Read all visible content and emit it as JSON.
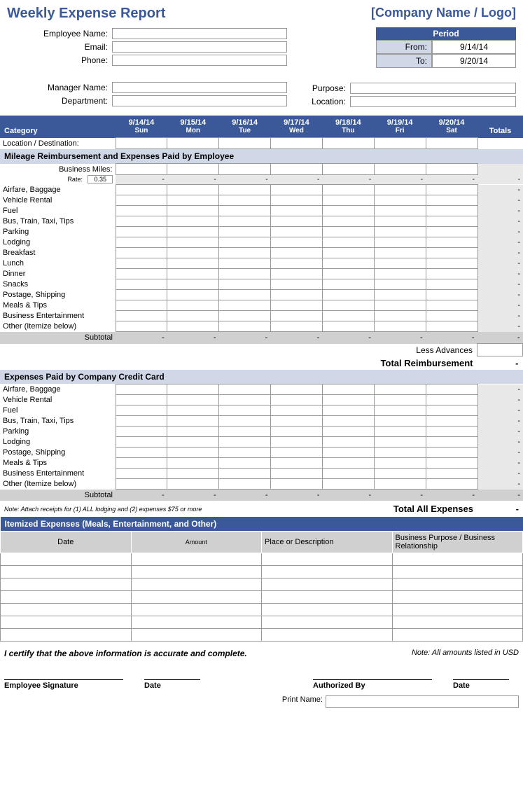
{
  "title": "Weekly Expense Report",
  "company": "[Company Name / Logo]",
  "fields": {
    "employee_name": "Employee Name:",
    "email": "Email:",
    "phone": "Phone:",
    "manager_name": "Manager Name:",
    "department": "Department:",
    "purpose": "Purpose:",
    "location": "Location:"
  },
  "period": {
    "header": "Period",
    "from_label": "From:",
    "from_value": "9/14/14",
    "to_label": "To:",
    "to_value": "9/20/14"
  },
  "columns": {
    "category": "Category",
    "days": [
      {
        "date": "9/14/14",
        "dow": "Sun"
      },
      {
        "date": "9/15/14",
        "dow": "Mon"
      },
      {
        "date": "9/16/14",
        "dow": "Tue"
      },
      {
        "date": "9/17/14",
        "dow": "Wed"
      },
      {
        "date": "9/18/14",
        "dow": "Thu"
      },
      {
        "date": "9/19/14",
        "dow": "Fri"
      },
      {
        "date": "9/20/14",
        "dow": "Sat"
      }
    ],
    "totals": "Totals"
  },
  "location_row": "Location / Destination:",
  "section1": {
    "title": "Mileage Reimbursement and Expenses Paid by Employee",
    "business_miles": "Business Miles:",
    "rate_label": "Rate:",
    "rate_value": "0.35",
    "dash": "-",
    "categories": [
      "Airfare, Baggage",
      "Vehicle Rental",
      "Fuel",
      "Bus, Train, Taxi, Tips",
      "Parking",
      "Lodging",
      "Breakfast",
      "Lunch",
      "Dinner",
      "Snacks",
      "Postage, Shipping",
      "Meals & Tips",
      "Business Entertainment",
      "Other (Itemize below)"
    ],
    "subtotal": "Subtotal",
    "less_advances": "Less Advances",
    "total_reimbursement": "Total Reimbursement"
  },
  "section2": {
    "title": "Expenses Paid by Company Credit Card",
    "categories": [
      "Airfare, Baggage",
      "Vehicle Rental",
      "Fuel",
      "Bus, Train, Taxi, Tips",
      "Parking",
      "Lodging",
      "Postage, Shipping",
      "Meals & Tips",
      "Business Entertainment",
      "Other (Itemize below)"
    ],
    "subtotal": "Subtotal"
  },
  "note_receipts": "Note:  Attach receipts for (1) ALL lodging and (2) expenses $75 or more",
  "total_all_expenses": "Total All Expenses",
  "itemized": {
    "title": "Itemized Expenses (Meals, Entertainment, and Other)",
    "col_date": "Date",
    "col_amount": "Amount",
    "col_place": "Place or Description",
    "col_purpose": "Business Purpose / Business Relationship"
  },
  "certify": "I certify that the above information is accurate and complete.",
  "usd_note": "Note: All amounts listed in USD",
  "sig": {
    "employee": "Employee Signature",
    "date": "Date",
    "authorized": "Authorized By",
    "print_name": "Print Name:"
  }
}
